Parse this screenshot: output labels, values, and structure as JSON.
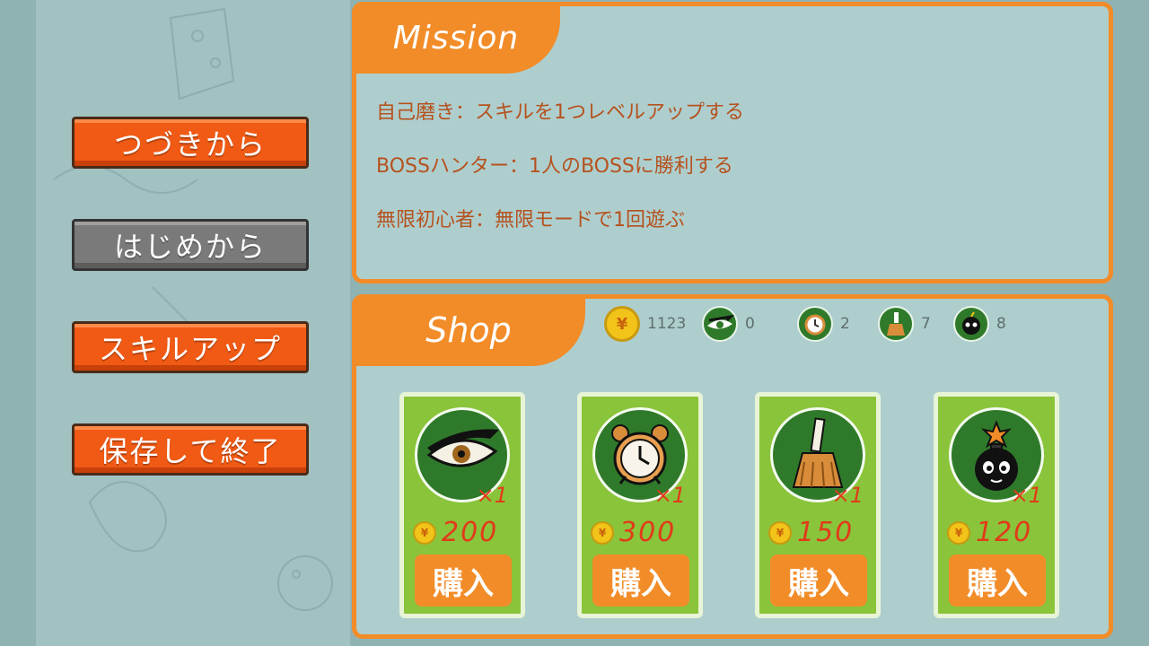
{
  "menu": {
    "continue_label": "つづきから",
    "new_game_label": "はじめから",
    "skill_up_label": "スキルアップ",
    "save_exit_label": "保存して終了"
  },
  "mission": {
    "title": "Mission",
    "items": [
      "自己磨き：スキルを1つレベルアップする",
      "BOSSハンター：1人のBOSSに勝利する",
      "無限初心者：無限モードで1回遊ぶ"
    ]
  },
  "shop": {
    "title": "Shop",
    "stats": {
      "coins": "1123",
      "eye": "0",
      "clock": "2",
      "broom": "7",
      "bomb": "8"
    },
    "coin_symbol": "¥",
    "items": [
      {
        "icon": "eye-icon",
        "qty": "×1",
        "price": "200",
        "buy_label": "購入"
      },
      {
        "icon": "clock-icon",
        "qty": "×1",
        "price": "300",
        "buy_label": "購入"
      },
      {
        "icon": "broom-icon",
        "qty": "×1",
        "price": "150",
        "buy_label": "購入"
      },
      {
        "icon": "bomb-icon",
        "qty": "×1",
        "price": "120",
        "buy_label": "購入"
      }
    ]
  },
  "colors": {
    "accent_orange": "#f28c28",
    "button_orange": "#f05a14",
    "price_red": "#e23a1a",
    "card_green": "#8ac43a"
  }
}
